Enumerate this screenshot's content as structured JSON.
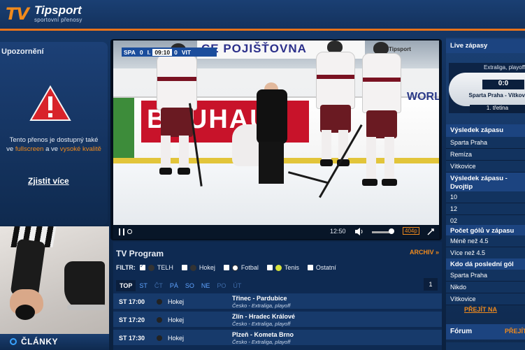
{
  "header": {
    "logo_mark": "TV",
    "brand": "Tipsport",
    "brand_sub": "sportovní přenosy"
  },
  "notice": {
    "title": "Upozornění",
    "text_1": "Tento přenos je dostupný také",
    "text_2a": "ve ",
    "text_2b": "fullscreen",
    "text_2c": " a ve ",
    "text_2d": "vysoké kvalitě",
    "more_link": "Zjistit více"
  },
  "articles": {
    "label": "ČLÁNKY"
  },
  "video": {
    "ad_banner": "CE POJIŠŤOVNA",
    "board_ad": "BAUHAUS",
    "board_ad_right": "WORLD",
    "channel": "Tipsport",
    "scorebar": {
      "home": "SPA",
      "home_score": "0",
      "period": "I.",
      "clock": "09:10",
      "away_score": "0",
      "away": "VIT"
    }
  },
  "player_controls": {
    "time": "12:50",
    "quality": "404p"
  },
  "tv_program": {
    "title": "TV Program",
    "archive_link": "ARCHIV »",
    "filter_label": "FILTR:",
    "filters": [
      {
        "label": "TELH",
        "checked": true
      },
      {
        "label": "Hokej",
        "checked": false
      },
      {
        "label": "Fotbal",
        "checked": false
      },
      {
        "label": "Tenis",
        "checked": false
      },
      {
        "label": "Ostatní",
        "checked": false
      }
    ],
    "days": [
      "TOP",
      "ST",
      "ČT",
      "PÁ",
      "SO",
      "NE",
      "PO",
      "ÚT"
    ],
    "page": "1",
    "rows": [
      {
        "time": "ST 17:00",
        "sport": "Hokej",
        "match": "Třinec - Pardubice",
        "competition": "Česko - Extraliga, playoff"
      },
      {
        "time": "ST 17:20",
        "sport": "Hokej",
        "match": "Zlín - Hradec Králové",
        "competition": "Česko - Extraliga, playoff"
      },
      {
        "time": "ST 17:30",
        "sport": "Hokej",
        "match": "Plzeň - Kometa Brno",
        "competition": "Česko - Extraliga, playoff"
      }
    ]
  },
  "live": {
    "title": "Live zápasy",
    "league": "Extraliga, playoff",
    "score": "0:0",
    "teams": "Sparta Praha - Vítkov",
    "period": "1. třetina"
  },
  "odds": {
    "result_title": "Výsledek zápasu",
    "result_options": [
      "Sparta Praha",
      "Remíza",
      "Vítkovice"
    ],
    "double_title_1": "Výsledek zápasu -",
    "double_title_2": "Dvojtip",
    "double_options": [
      "10",
      "12",
      "02"
    ],
    "goals_title": "Počet gólů v zápasu",
    "goals_options": [
      "Méně než 4.5",
      "Více než 4.5"
    ],
    "last_goal_title": "Kdo dá poslední gól",
    "last_goal_options": [
      "Sparta Praha",
      "Nikdo",
      "Vítkovice"
    ],
    "more_link": "PŘEJÍT NA"
  },
  "forum": {
    "title": "Fórum",
    "link": "PŘEJÍT"
  },
  "colors": {
    "accent": "#f08a1c",
    "panel": "#1a3f73",
    "background": "#0c1f3a"
  }
}
